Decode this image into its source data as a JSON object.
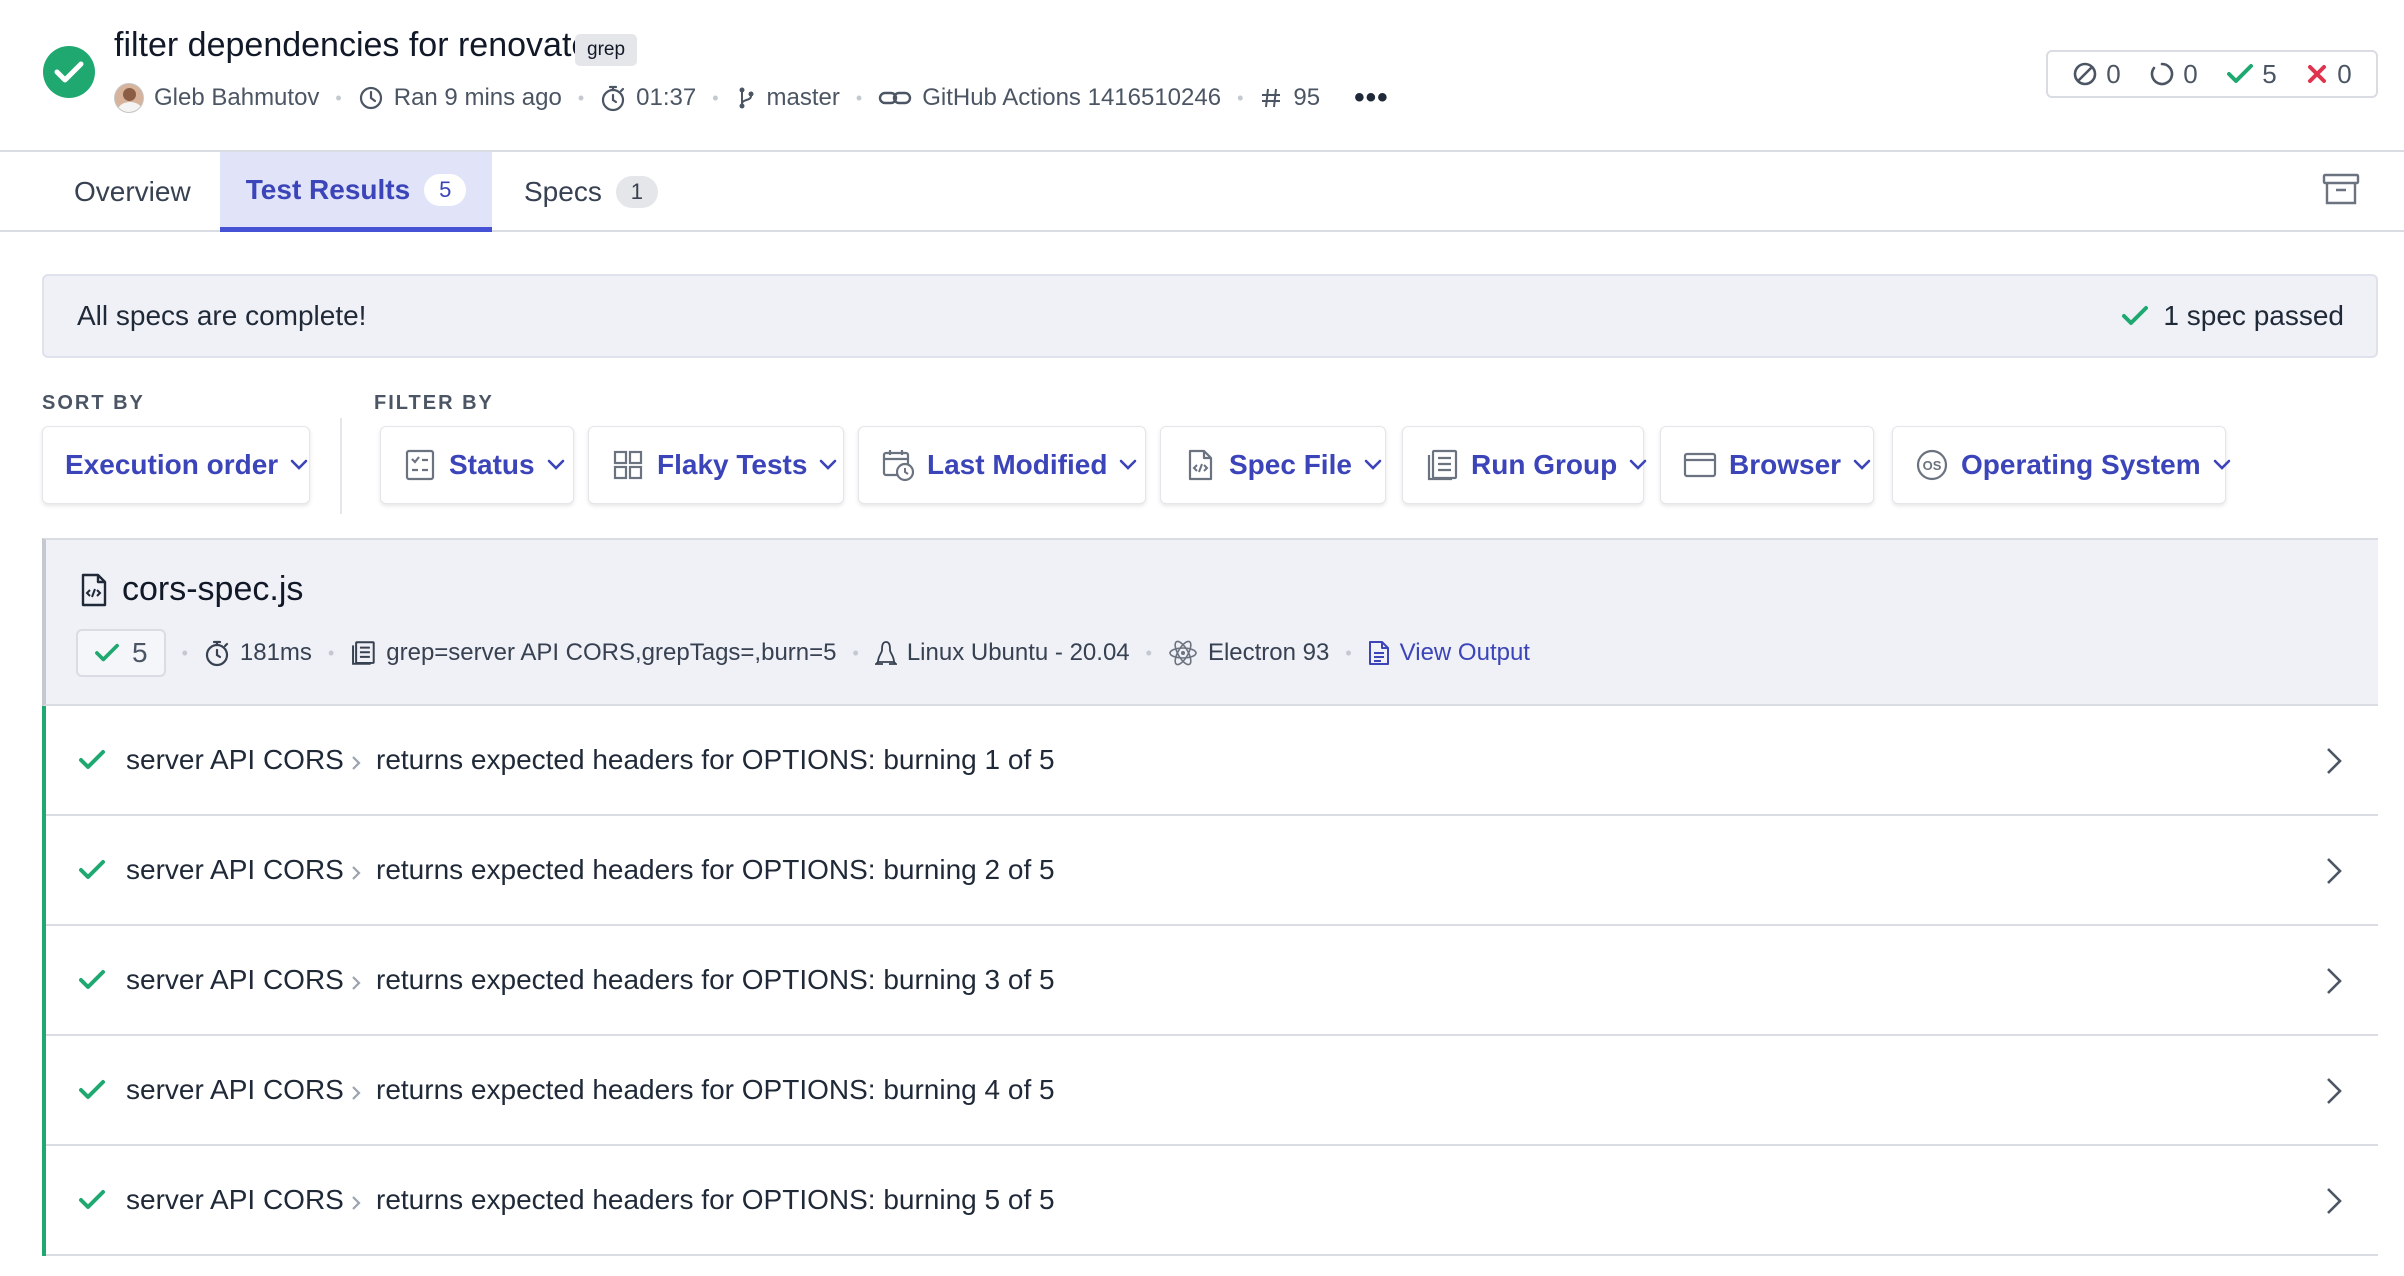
{
  "run": {
    "title": "filter dependencies for renovate",
    "tag": "grep",
    "author": "Gleb Bahmutov",
    "ran": "Ran 9 mins ago",
    "duration": "01:37",
    "branch": "master",
    "ci": "GitHub Actions 1416510246",
    "number": "95",
    "counts": {
      "skipped": "0",
      "pending": "0",
      "passed": "5",
      "failed": "0"
    },
    "status_color": "#1fa971"
  },
  "tabs": [
    {
      "label": "Overview",
      "badge": ""
    },
    {
      "label": "Test Results",
      "badge": "5"
    },
    {
      "label": "Specs",
      "badge": "1"
    }
  ],
  "banner": {
    "message": "All specs are complete!",
    "passed": "1 spec passed"
  },
  "sort": {
    "label": "SORT BY",
    "value": "Execution order"
  },
  "filter": {
    "label": "FILTER BY",
    "items": [
      {
        "label": "Status",
        "icon": "status-checklist-icon"
      },
      {
        "label": "Flaky Tests",
        "icon": "flaky-grid-icon"
      },
      {
        "label": "Last Modified",
        "icon": "calendar-clock-icon"
      },
      {
        "label": "Spec File",
        "icon": "code-file-icon"
      },
      {
        "label": "Run Group",
        "icon": "run-group-icon"
      },
      {
        "label": "Browser",
        "icon": "browser-window-icon"
      },
      {
        "label": "Operating System",
        "icon": "os-icon"
      }
    ]
  },
  "spec": {
    "name": "cors-spec.js",
    "passed": "5",
    "duration": "181ms",
    "group": "grep=server API CORS,grepTags=,burn=5",
    "os": "Linux Ubuntu - 20.04",
    "browser": "Electron 93",
    "view_output": "View Output"
  },
  "tests": [
    {
      "suite": "server API CORS",
      "title": "returns expected headers for OPTIONS: burning 1 of 5"
    },
    {
      "suite": "server API CORS",
      "title": "returns expected headers for OPTIONS: burning 2 of 5"
    },
    {
      "suite": "server API CORS",
      "title": "returns expected headers for OPTIONS: burning 3 of 5"
    },
    {
      "suite": "server API CORS",
      "title": "returns expected headers for OPTIONS: burning 4 of 5"
    },
    {
      "suite": "server API CORS",
      "title": "returns expected headers for OPTIONS: burning 5 of 5"
    }
  ]
}
